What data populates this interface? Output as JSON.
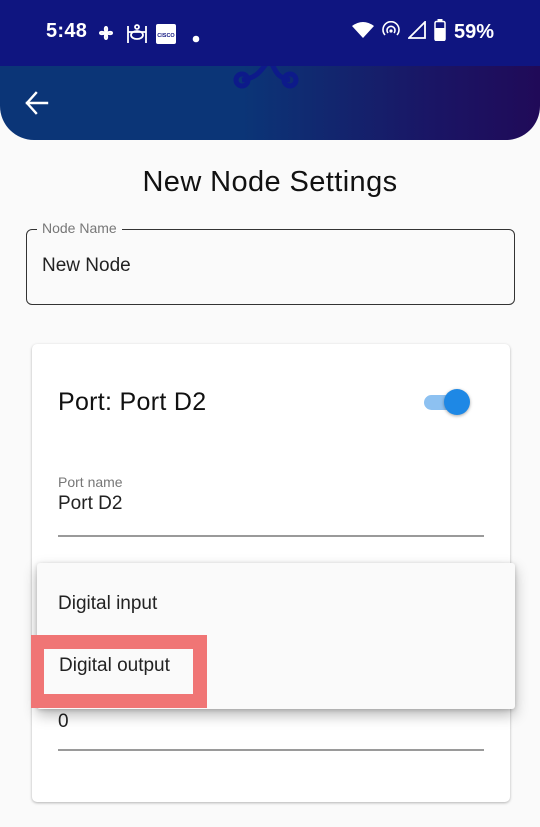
{
  "status_bar": {
    "time": "5:48",
    "left_icons": [
      "pinwheel-icon",
      "temple-icon",
      "cisco-icon",
      "notification-dot-icon"
    ],
    "cisco_label": "CISCO",
    "right_icons": [
      "wifi-icon",
      "hotspot-icon",
      "cell-signal-icon",
      "battery-icon"
    ],
    "battery_percent": "59%"
  },
  "app_bar": {
    "back_icon": "arrow-back-icon",
    "logo_icon": "node-logo-icon",
    "colors": {
      "start": "#0b3577",
      "end": "#200a58"
    }
  },
  "page": {
    "title": "New Node Settings"
  },
  "node_name_field": {
    "label": "Node Name",
    "value": "New Node"
  },
  "port_card": {
    "title": "Port: Port D2",
    "enabled": true,
    "toggle_color": "#1e88e5",
    "port_name_field": {
      "label": "Port name",
      "value": "Port D2"
    },
    "value_field": {
      "value": "0"
    }
  },
  "dropdown": {
    "options": [
      "Digital input",
      "Digital output"
    ],
    "highlighted_option": "Digital output",
    "highlight_color": "#f07575"
  }
}
